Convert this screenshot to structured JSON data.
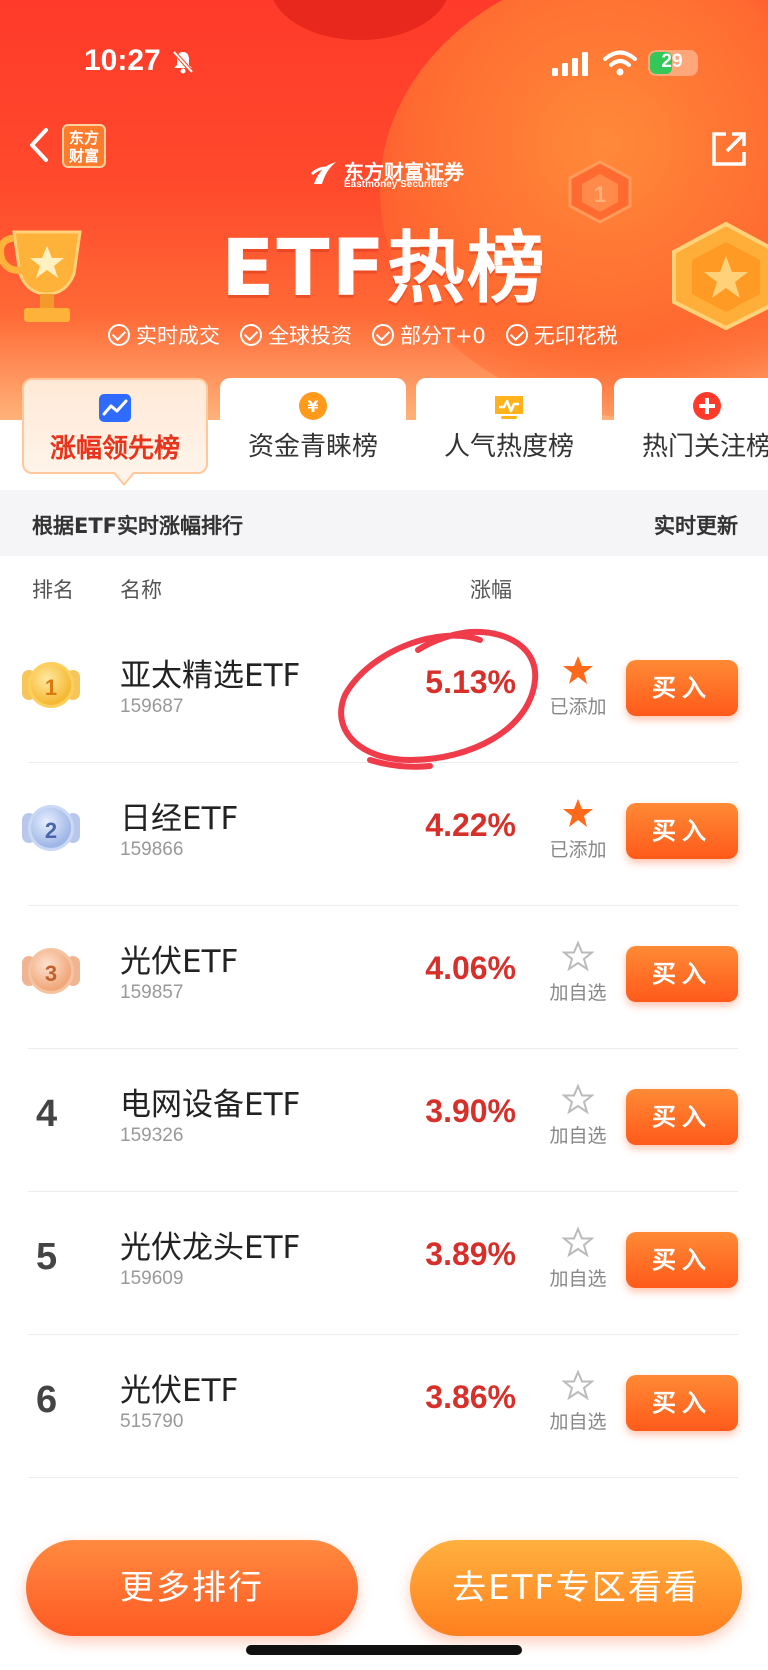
{
  "status_bar": {
    "time": "10:27",
    "battery": "29"
  },
  "header": {
    "brand_badge": "东方财富",
    "logo_cn": "东方财富证券",
    "logo_en": "Eastmoney Securities",
    "title": "ETF热榜",
    "features": [
      "实时成交",
      "全球投资",
      "部分T+0",
      "无印花税"
    ]
  },
  "tabs": [
    {
      "label": "涨幅领先榜",
      "active": true
    },
    {
      "label": "资金青睐榜",
      "active": false
    },
    {
      "label": "人气热度榜",
      "active": false
    },
    {
      "label": "热门关注榜",
      "active": false
    }
  ],
  "subbar": {
    "description": "根据ETF实时涨幅排行",
    "update": "实时更新"
  },
  "table": {
    "headers": {
      "rank": "排名",
      "name": "名称",
      "change": "涨幅"
    },
    "rows": [
      {
        "rank": "1",
        "name": "亚太精选ETF",
        "code": "159687",
        "change": "5.13%",
        "fav_label": "已添加",
        "favorited": true,
        "buy": "买入"
      },
      {
        "rank": "2",
        "name": "日经ETF",
        "code": "159866",
        "change": "4.22%",
        "fav_label": "已添加",
        "favorited": true,
        "buy": "买入"
      },
      {
        "rank": "3",
        "name": "光伏ETF",
        "code": "159857",
        "change": "4.06%",
        "fav_label": "加自选",
        "favorited": false,
        "buy": "买入"
      },
      {
        "rank": "4",
        "name": "电网设备ETF",
        "code": "159326",
        "change": "3.90%",
        "fav_label": "加自选",
        "favorited": false,
        "buy": "买入"
      },
      {
        "rank": "5",
        "name": "光伏龙头ETF",
        "code": "159609",
        "change": "3.89%",
        "fav_label": "加自选",
        "favorited": false,
        "buy": "买入"
      },
      {
        "rank": "6",
        "name": "光伏ETF",
        "code": "515790",
        "change": "3.86%",
        "fav_label": "加自选",
        "favorited": false,
        "buy": "买入"
      }
    ]
  },
  "bottom": {
    "more_label": "更多排行",
    "zone_label": "去ETF专区看看"
  },
  "colors": {
    "accent": "#ff4a2c",
    "gain": "#d7302a",
    "star_filled": "#ff6a1a",
    "star_empty": "#bbbbbb"
  }
}
